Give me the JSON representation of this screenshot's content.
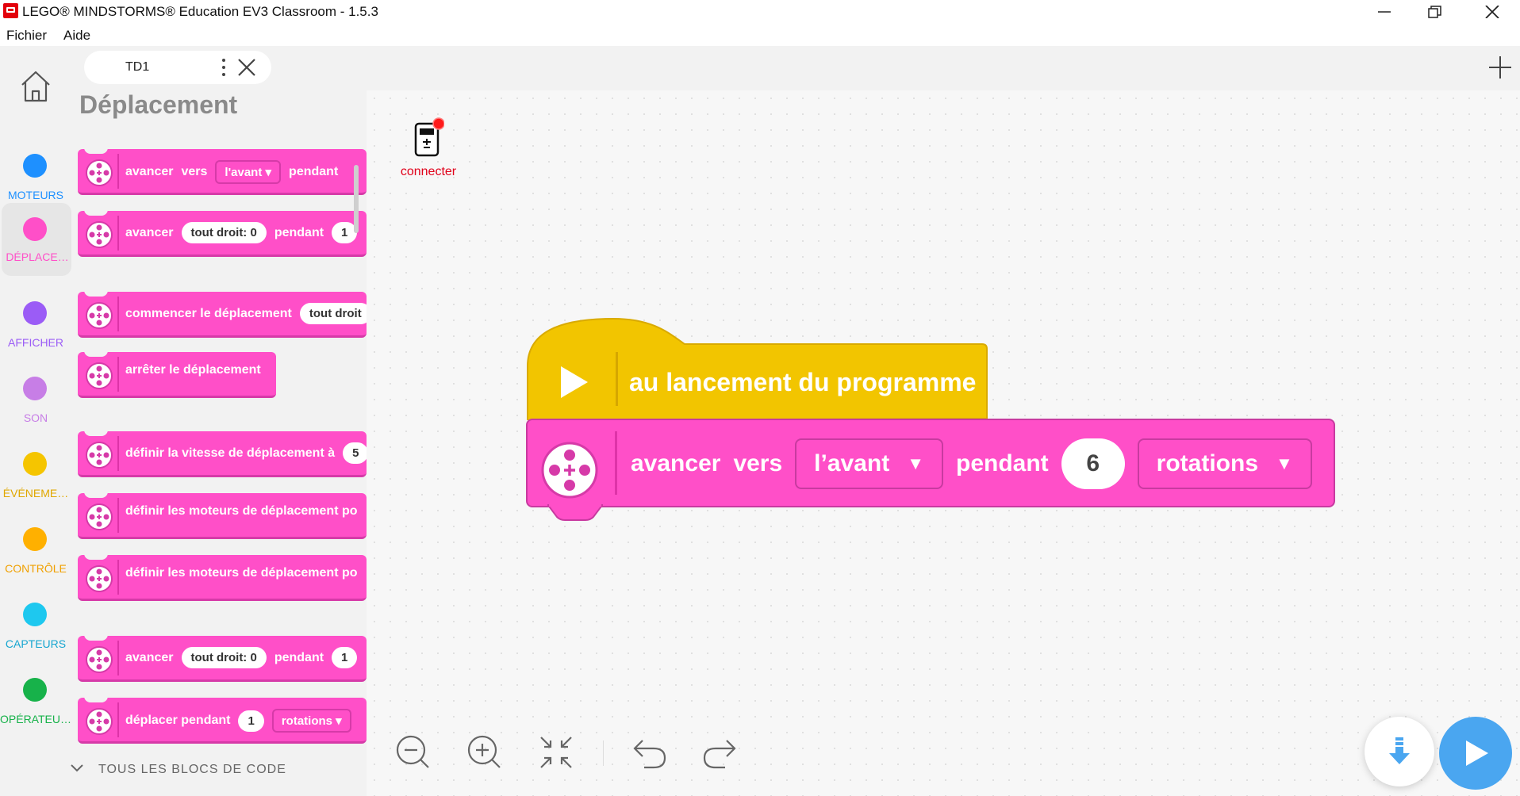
{
  "window": {
    "title": "LEGO® MINDSTORMS® Education EV3 Classroom - 1.5.3",
    "controls": [
      "minimize",
      "restore",
      "close"
    ]
  },
  "menu": {
    "items": [
      "Fichier",
      "Aide"
    ]
  },
  "tabs": [
    {
      "label": "TD1"
    }
  ],
  "categories": [
    {
      "label": "MOTEURS",
      "color": "#1e90ff"
    },
    {
      "label": "DÉPLACE…",
      "color": "#ff4fc8",
      "active": true
    },
    {
      "label": "AFFICHER",
      "color": "#9b5cf6"
    },
    {
      "label": "SON",
      "color": "#c77ee6"
    },
    {
      "label": "ÉVÉNEME…",
      "color": "#f5c500"
    },
    {
      "label": "CONTRÔLE",
      "color": "#ffb000"
    },
    {
      "label": "CAPTEURS",
      "color": "#1ec8ef"
    },
    {
      "label": "OPÉRATEU…",
      "color": "#17b24a"
    }
  ],
  "palette": {
    "title": "Déplacement",
    "blocks": [
      {
        "parts": [
          "avancer",
          "vers"
        ],
        "dropdown": "l'avant",
        "after": "pendant"
      },
      {
        "parts": [
          "avancer"
        ],
        "pill": "tout droit: 0",
        "after": "pendant",
        "pill2": "1"
      },
      {
        "parts": [
          "commencer le déplacement"
        ],
        "pill": "tout droit"
      },
      {
        "parts": [
          "arrêter le déplacement"
        ]
      },
      {
        "parts": [
          "définir la vitesse de déplacement à"
        ],
        "pill": "5"
      },
      {
        "parts": [
          "définir les moteurs de déplacement po"
        ]
      },
      {
        "parts": [
          "définir les moteurs de déplacement po"
        ]
      },
      {
        "parts": [
          "avancer"
        ],
        "pill": "tout droit: 0",
        "after": "pendant",
        "pill2": "1"
      },
      {
        "parts": [
          "déplacer pendant"
        ],
        "pill": "1",
        "dropdown": "rotations"
      }
    ],
    "all_blocks_label": "TOUS LES BLOCS DE CODE"
  },
  "canvas": {
    "connect_label": "connecter",
    "hat_block": {
      "label": "au lancement du programme",
      "color": "#f2c500"
    },
    "move_block": {
      "verb": "avancer",
      "vers": "vers",
      "direction": "l’avant",
      "pendant": "pendant",
      "amount": "6",
      "unit": "rotations",
      "color": "#ff4fc8"
    }
  },
  "toolbar": {
    "tools": [
      "zoom-out",
      "zoom-in",
      "recenter",
      "undo",
      "redo"
    ]
  }
}
